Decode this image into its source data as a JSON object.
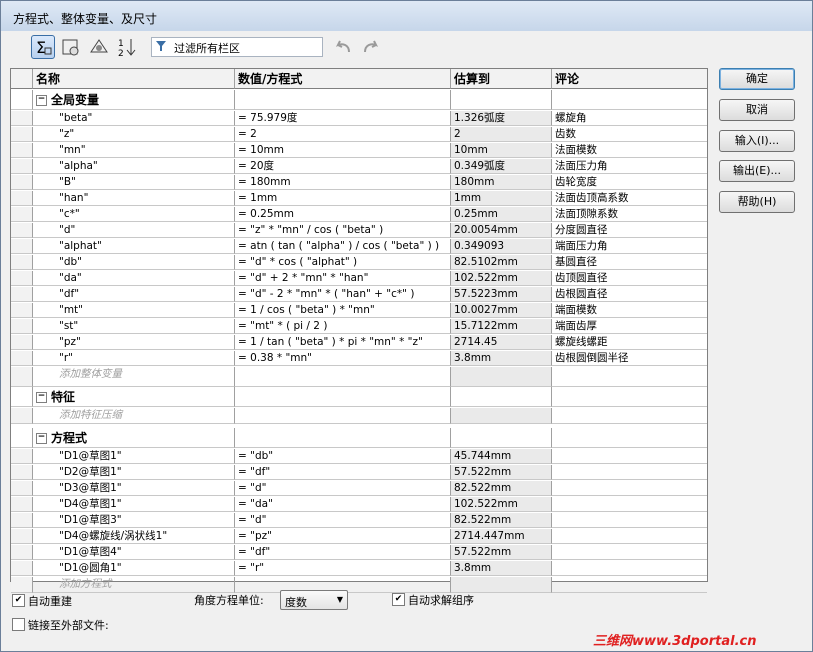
{
  "window": {
    "title": "方程式、整体变量、及尺寸"
  },
  "toolbar": {
    "filter_placeholder": "过滤所有栏区",
    "buttons": [
      {
        "name": "global-variables-view-icon",
        "active": true
      },
      {
        "name": "equation-view-icon",
        "active": false
      },
      {
        "name": "dimension-view-icon",
        "active": false
      },
      {
        "name": "ordered-view-icon",
        "active": false
      }
    ]
  },
  "columns": [
    "名称",
    "数值/方程式",
    "估算到",
    "评论"
  ],
  "sections": {
    "globals": {
      "title": "全局变量",
      "add": "添加整体变量"
    },
    "features": {
      "title": "特征",
      "add": "添加特征压缩"
    },
    "equations": {
      "title": "方程式",
      "add": "添加方程式"
    }
  },
  "global_rows": [
    {
      "name": "\"beta\"",
      "value": "= 75.979度",
      "eval": "1.326弧度",
      "comment": "螺旋角"
    },
    {
      "name": "\"z\"",
      "value": "= 2",
      "eval": "2",
      "comment": "齿数"
    },
    {
      "name": "\"mn\"",
      "value": "= 10mm",
      "eval": "10mm",
      "comment": "法面模数"
    },
    {
      "name": "\"alpha\"",
      "value": "= 20度",
      "eval": "0.349弧度",
      "comment": "法面压力角"
    },
    {
      "name": "\"B\"",
      "value": "= 180mm",
      "eval": "180mm",
      "comment": "齿轮宽度"
    },
    {
      "name": "\"han\"",
      "value": "= 1mm",
      "eval": "1mm",
      "comment": "法面齿顶高系数"
    },
    {
      "name": "\"c*\"",
      "value": "= 0.25mm",
      "eval": "0.25mm",
      "comment": "法面顶隙系数"
    },
    {
      "name": "\"d\"",
      "value": "= \"z\" * \"mn\" / cos ( \"beta\" )",
      "eval": "20.0054mm",
      "comment": "分度圆直径"
    },
    {
      "name": "\"alphat\"",
      "value": "= atn ( tan ( \"alpha\" ) / cos ( \"beta\" ) )",
      "eval": "0.349093",
      "comment": "端面压力角"
    },
    {
      "name": "\"db\"",
      "value": "= \"d\" * cos ( \"alphat\" )",
      "eval": "82.5102mm",
      "comment": "基圆直径"
    },
    {
      "name": "\"da\"",
      "value": "= \"d\" + 2 * \"mn\" * \"han\"",
      "eval": "102.522mm",
      "comment": "齿顶圆直径"
    },
    {
      "name": "\"df\"",
      "value": "= \"d\" - 2 * \"mn\" * ( \"han\" + \"c*\" )",
      "eval": "57.5223mm",
      "comment": "齿根圆直径"
    },
    {
      "name": "\"mt\"",
      "value": "= 1 / cos ( \"beta\" ) * \"mn\"",
      "eval": "10.0027mm",
      "comment": "端面模数"
    },
    {
      "name": "\"st\"",
      "value": "= \"mt\" * ( pi / 2 )",
      "eval": "15.7122mm",
      "comment": "端面齿厚"
    },
    {
      "name": "\"pz\"",
      "value": "= 1 / tan ( \"beta\" ) * pi * \"mn\" * \"z\"",
      "eval": "2714.45",
      "comment": "螺旋线螺距"
    },
    {
      "name": "\"r\"",
      "value": "= 0.38 * \"mn\"",
      "eval": "3.8mm",
      "comment": "齿根圆倒圆半径"
    }
  ],
  "equation_rows": [
    {
      "name": "\"D1@草图1\"",
      "value": "= \"db\"",
      "eval": "45.744mm",
      "comment": ""
    },
    {
      "name": "\"D2@草图1\"",
      "value": "= \"df\"",
      "eval": "57.522mm",
      "comment": ""
    },
    {
      "name": "\"D3@草图1\"",
      "value": "= \"d\"",
      "eval": "82.522mm",
      "comment": ""
    },
    {
      "name": "\"D4@草图1\"",
      "value": "= \"da\"",
      "eval": "102.522mm",
      "comment": ""
    },
    {
      "name": "\"D1@草图3\"",
      "value": "= \"d\"",
      "eval": "82.522mm",
      "comment": ""
    },
    {
      "name": "\"D4@螺旋线/涡状线1\"",
      "value": "= \"pz\"",
      "eval": "2714.447mm",
      "comment": ""
    },
    {
      "name": "\"D1@草图4\"",
      "value": "= \"df\"",
      "eval": "57.522mm",
      "comment": ""
    },
    {
      "name": "\"D1@圆角1\"",
      "value": "= \"r\"",
      "eval": "3.8mm",
      "comment": ""
    }
  ],
  "side_buttons": [
    "确定",
    "取消",
    "输入(I)...",
    "输出(E)...",
    "帮助(H)"
  ],
  "bottom": {
    "auto_rebuild": {
      "label": "自动重建",
      "checked": true
    },
    "angle_unit_label": "角度方程单位:",
    "angle_unit_value": "度数",
    "auto_solve": {
      "label": "自动求解组序",
      "checked": true
    },
    "link_external": {
      "label": "链接至外部文件:",
      "checked": false
    }
  },
  "watermark": "三维网www.3dportal.cn"
}
